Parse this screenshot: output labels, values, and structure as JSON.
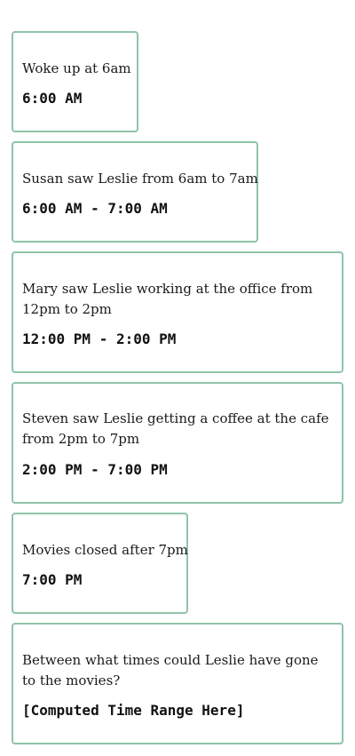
{
  "cards": [
    {
      "text": "Woke up at 6am",
      "time": "6:00 AM"
    },
    {
      "text": "Susan saw Leslie from 6am to 7am",
      "time": "6:00 AM - 7:00 AM"
    },
    {
      "text": "Mary saw Leslie working at the office from 12pm to 2pm",
      "time": "12:00 PM - 2:00 PM"
    },
    {
      "text": "Steven saw Leslie getting a coffee at the cafe from 2pm to 7pm",
      "time": "2:00 PM - 7:00 PM"
    },
    {
      "text": "Movies closed after 7pm",
      "time": "7:00 PM"
    },
    {
      "text": "Between what times could Leslie have gone to the movies?",
      "time": "[Computed Time Range Here]"
    }
  ],
  "colors": {
    "card_border": "#8fc4a8"
  }
}
